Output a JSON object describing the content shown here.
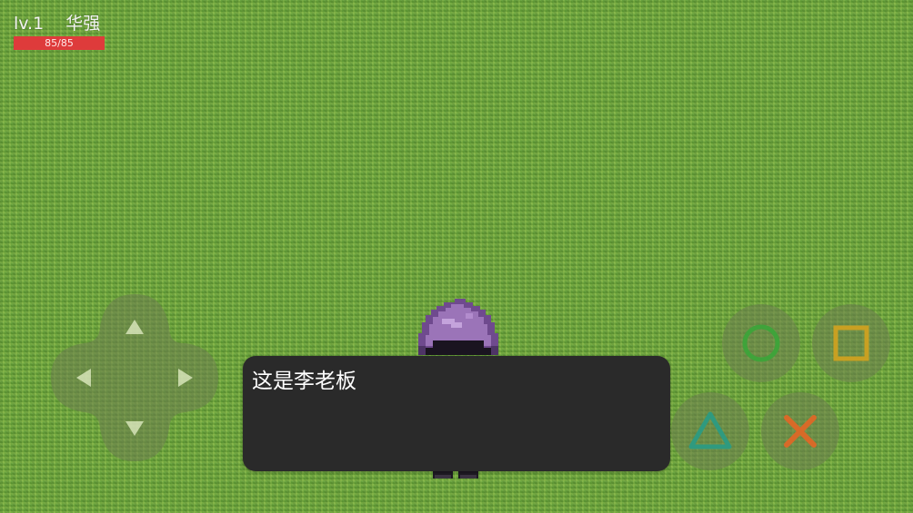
{
  "hud": {
    "level": "lv.1",
    "name": "华强",
    "hp_text": "85/85",
    "hp_fraction": 1.0,
    "hp_color": "#de3b3b"
  },
  "dialog": {
    "text": "这是李老板"
  },
  "dpad": {
    "icons": [
      "up-arrow-icon",
      "down-arrow-icon",
      "left-arrow-icon",
      "right-arrow-icon"
    ]
  },
  "action_buttons": [
    {
      "name": "circle-button",
      "icon": "circle-icon",
      "color": "#3fa33a"
    },
    {
      "name": "square-button",
      "icon": "square-icon",
      "color": "#c9a022"
    },
    {
      "name": "triangle-button",
      "icon": "triangle-icon",
      "color": "#2f9a7f"
    },
    {
      "name": "cross-button",
      "icon": "cross-icon",
      "color": "#d86a28"
    }
  ]
}
